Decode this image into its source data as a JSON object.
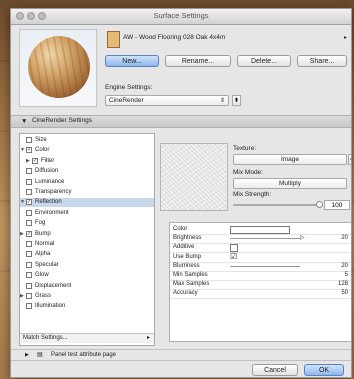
{
  "window": {
    "title": "Surface Settings"
  },
  "material": {
    "name": "AW - Wood Flooring 028 Oak 4x4m",
    "swatch_color": "#e8b973",
    "buttons": {
      "new": "New...",
      "rename": "Rename...",
      "delete": "Delete...",
      "share": "Share..."
    }
  },
  "engine": {
    "label": "Engine Settings:",
    "value": "CineRender"
  },
  "section": {
    "title": "CineRender Settings"
  },
  "channels": [
    {
      "label": "Size",
      "checked": false
    },
    {
      "label": "Color",
      "checked": true
    },
    {
      "label": "Filter",
      "checked": true
    },
    {
      "label": "Diffusion",
      "checked": false
    },
    {
      "label": "Luminance",
      "checked": false
    },
    {
      "label": "Transparency",
      "checked": false
    },
    {
      "label": "Reflection",
      "checked": true
    },
    {
      "label": "Environment",
      "checked": false
    },
    {
      "label": "Fog",
      "checked": false
    },
    {
      "label": "Bump",
      "checked": true
    },
    {
      "label": "Normal",
      "checked": false
    },
    {
      "label": "Alpha",
      "checked": false
    },
    {
      "label": "Specular",
      "checked": false
    },
    {
      "label": "Glow",
      "checked": false
    },
    {
      "label": "Displacement",
      "checked": false
    },
    {
      "label": "Grass",
      "checked": false
    },
    {
      "label": "Illumination",
      "checked": false
    }
  ],
  "match_settings": "Match Settings...",
  "texture": {
    "label": "Texture:",
    "type": "Image",
    "mix_mode_label": "Mix Mode:",
    "mix_mode": "Multiply",
    "mix_strength_label": "Mix Strength:",
    "mix_strength": "100"
  },
  "properties": [
    {
      "name": "Color",
      "value": ""
    },
    {
      "name": "Brightness",
      "value": "20"
    },
    {
      "name": "Additive",
      "value": ""
    },
    {
      "name": "Use Bump",
      "value": ""
    },
    {
      "name": "Blurriness",
      "value": "20"
    },
    {
      "name": "Min Samples",
      "value": "5"
    },
    {
      "name": "Max Samples",
      "value": "128"
    },
    {
      "name": "Accuracy",
      "value": "50"
    }
  ],
  "checks": {
    "use_bump": "☑"
  },
  "panel_test": "Panel test attribute page",
  "footer": {
    "cancel": "Cancel",
    "ok": "OK"
  },
  "colors": {
    "selection": "#c9d7ea",
    "default_button": "#8fb8ee"
  }
}
